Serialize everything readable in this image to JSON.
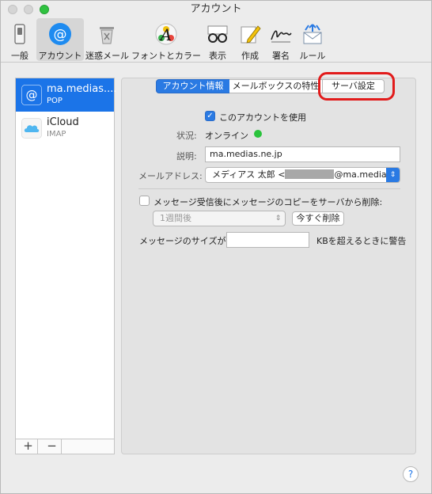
{
  "window": {
    "title": "アカウント"
  },
  "toolbar": {
    "items": [
      {
        "label": "一般",
        "icon": "switch-icon"
      },
      {
        "label": "アカウント",
        "icon": "at-sign-icon",
        "selected": true
      },
      {
        "label": "迷惑メール",
        "icon": "trash-bin-icon"
      },
      {
        "label": "フォントとカラー",
        "icon": "font-letter-a-icon"
      },
      {
        "label": "表示",
        "icon": "glasses-icon"
      },
      {
        "label": "作成",
        "icon": "pencil-icon"
      },
      {
        "label": "署名",
        "icon": "signature-icon"
      },
      {
        "label": "ルール",
        "icon": "envelope-arrows-icon"
      }
    ]
  },
  "sidebar": {
    "accounts": [
      {
        "name": "ma.medias....",
        "type": "POP",
        "icon": "at-sign-icon",
        "selected": true
      },
      {
        "name": "iCloud",
        "type": "IMAP",
        "icon": "cloud-icon",
        "selected": false
      }
    ],
    "add_label": "+",
    "remove_label": "−"
  },
  "tabs": [
    {
      "label": "アカウント情報",
      "selected": true
    },
    {
      "label": "メールボックスの特性",
      "selected": false
    },
    {
      "label": "サーバ設定",
      "selected": false
    }
  ],
  "form": {
    "use_account_label": "このアカウントを使用",
    "use_account_checked": true,
    "status_label": "状況:",
    "status_value": "オンライン",
    "description_label": "説明:",
    "description_value": "ma.medias.ne.jp",
    "email_label": "メールアドレス:",
    "email_prefix": "メディアス 太郎 <",
    "email_suffix": "@ma.medias....",
    "remove_copy_label": "メッセージ受信後にメッセージのコピーをサーバから削除:",
    "remove_copy_checked": false,
    "remove_after_value": "1週間後",
    "remove_now_label": "今すぐ削除",
    "message_size_label": "メッセージのサイズが",
    "message_size_value": "",
    "message_size_suffix": "KBを超えるときに警告"
  },
  "help_label": "?",
  "colors": {
    "accent": "#1b74e8",
    "status_online": "#2ac33c",
    "highlight_ring": "#e21b1b"
  }
}
